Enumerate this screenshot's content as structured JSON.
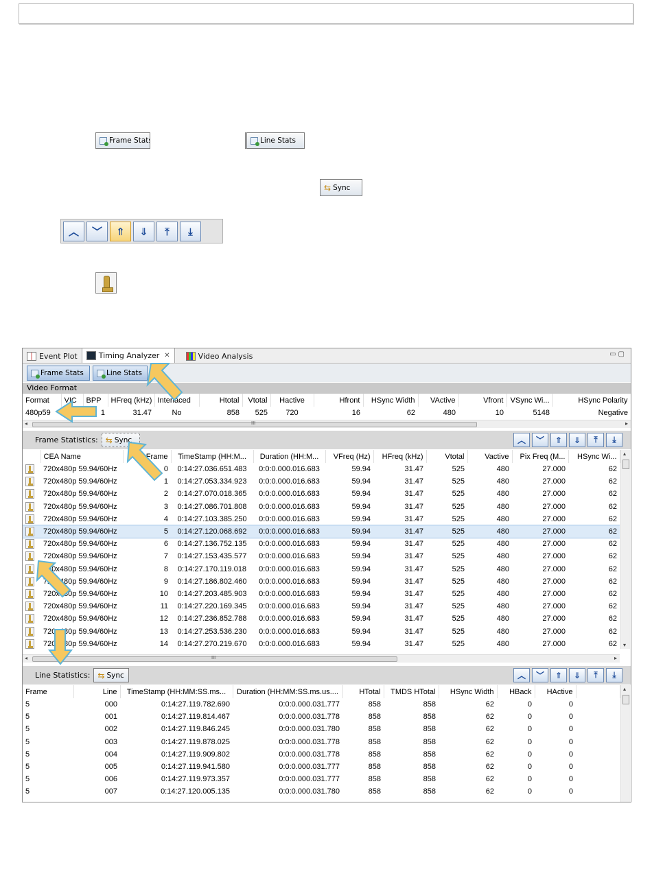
{
  "labels": {
    "frame_stats": "Frame Stats",
    "line_stats": "Line Stats",
    "sync": "Sync"
  },
  "nav_icons": [
    "nav-up-icon",
    "nav-down-icon",
    "nav-page-up-icon",
    "nav-page-down-icon",
    "nav-first-icon",
    "nav-last-icon"
  ],
  "tabs": [
    {
      "label": "Event Plot",
      "icon": "event-plot-icon"
    },
    {
      "label": "Timing Analyzer",
      "icon": "timing-analyzer-icon",
      "active": true
    },
    {
      "label": "Video Analysis",
      "icon": "video-analysis-icon"
    }
  ],
  "video_format": {
    "title": "Video Format",
    "headers": [
      "Format",
      "VIC",
      "BPP",
      "HFreq (kHz)",
      "Interlaced",
      "Htotal",
      "Vtotal",
      "Hactive",
      "Hfront",
      "HSync Width",
      "VActive",
      "Vfront",
      "VSync Wi...",
      "HSync Polarity"
    ],
    "row": [
      "480p59",
      "",
      "1",
      "31.47",
      "No",
      "858",
      "525",
      "720",
      "16",
      "62",
      "480",
      "10",
      "5148",
      "Negative"
    ]
  },
  "frame_statistics": {
    "title": "Frame Statistics:",
    "headers": [
      "",
      "CEA Name",
      "Frame",
      "TimeStamp (HH:M...",
      "Duration (HH:M...",
      "VFreq (Hz)",
      "HFreq (kHz)",
      "Vtotal",
      "Vactive",
      "Pix Freq (M...",
      "HSync Wi..."
    ],
    "selected_index": 5,
    "rows": [
      [
        "720x480p 59.94/60Hz",
        "0",
        "0:14:27.036.651.483",
        "0:0:0.000.016.683",
        "59.94",
        "31.47",
        "525",
        "480",
        "27.000",
        "62"
      ],
      [
        "720x480p 59.94/60Hz",
        "1",
        "0:14:27.053.334.923",
        "0:0:0.000.016.683",
        "59.94",
        "31.47",
        "525",
        "480",
        "27.000",
        "62"
      ],
      [
        "720x480p 59.94/60Hz",
        "2",
        "0:14:27.070.018.365",
        "0:0:0.000.016.683",
        "59.94",
        "31.47",
        "525",
        "480",
        "27.000",
        "62"
      ],
      [
        "720x480p 59.94/60Hz",
        "3",
        "0:14:27.086.701.808",
        "0:0:0.000.016.683",
        "59.94",
        "31.47",
        "525",
        "480",
        "27.000",
        "62"
      ],
      [
        "720x480p 59.94/60Hz",
        "4",
        "0:14:27.103.385.250",
        "0:0:0.000.016.683",
        "59.94",
        "31.47",
        "525",
        "480",
        "27.000",
        "62"
      ],
      [
        "720x480p 59.94/60Hz",
        "5",
        "0:14:27.120.068.692",
        "0:0:0.000.016.683",
        "59.94",
        "31.47",
        "525",
        "480",
        "27.000",
        "62"
      ],
      [
        "720x480p 59.94/60Hz",
        "6",
        "0:14:27.136.752.135",
        "0:0:0.000.016.683",
        "59.94",
        "31.47",
        "525",
        "480",
        "27.000",
        "62"
      ],
      [
        "720x480p 59.94/60Hz",
        "7",
        "0:14:27.153.435.577",
        "0:0:0.000.016.683",
        "59.94",
        "31.47",
        "525",
        "480",
        "27.000",
        "62"
      ],
      [
        "720x480p 59.94/60Hz",
        "8",
        "0:14:27.170.119.018",
        "0:0:0.000.016.683",
        "59.94",
        "31.47",
        "525",
        "480",
        "27.000",
        "62"
      ],
      [
        "720x480p 59.94/60Hz",
        "9",
        "0:14:27.186.802.460",
        "0:0:0.000.016.683",
        "59.94",
        "31.47",
        "525",
        "480",
        "27.000",
        "62"
      ],
      [
        "720x480p 59.94/60Hz",
        "10",
        "0:14:27.203.485.903",
        "0:0:0.000.016.683",
        "59.94",
        "31.47",
        "525",
        "480",
        "27.000",
        "62"
      ],
      [
        "720x480p 59.94/60Hz",
        "11",
        "0:14:27.220.169.345",
        "0:0:0.000.016.683",
        "59.94",
        "31.47",
        "525",
        "480",
        "27.000",
        "62"
      ],
      [
        "720x480p 59.94/60Hz",
        "12",
        "0:14:27.236.852.788",
        "0:0:0.000.016.683",
        "59.94",
        "31.47",
        "525",
        "480",
        "27.000",
        "62"
      ],
      [
        "720x480p 59.94/60Hz",
        "13",
        "0:14:27.253.536.230",
        "0:0:0.000.016.683",
        "59.94",
        "31.47",
        "525",
        "480",
        "27.000",
        "62"
      ],
      [
        "720x480p 59.94/60Hz",
        "14",
        "0:14:27.270.219.670",
        "0:0:0.000.016.683",
        "59.94",
        "31.47",
        "525",
        "480",
        "27.000",
        "62"
      ]
    ]
  },
  "line_statistics": {
    "title": "Line Statistics:",
    "headers": [
      "Frame",
      "Line",
      "TimeStamp (HH:MM:SS.ms...",
      "Duration (HH:MM:SS.ms.us....",
      "HTotal",
      "TMDS HTotal",
      "HSync Width",
      "HBack",
      "HActive"
    ],
    "rows": [
      [
        "5",
        "000",
        "0:14:27.119.782.690",
        "0:0:0.000.031.777",
        "858",
        "858",
        "62",
        "0",
        "0"
      ],
      [
        "5",
        "001",
        "0:14:27.119.814.467",
        "0:0:0.000.031.778",
        "858",
        "858",
        "62",
        "0",
        "0"
      ],
      [
        "5",
        "002",
        "0:14:27.119.846.245",
        "0:0:0.000.031.780",
        "858",
        "858",
        "62",
        "0",
        "0"
      ],
      [
        "5",
        "003",
        "0:14:27.119.878.025",
        "0:0:0.000.031.778",
        "858",
        "858",
        "62",
        "0",
        "0"
      ],
      [
        "5",
        "004",
        "0:14:27.119.909.802",
        "0:0:0.000.031.778",
        "858",
        "858",
        "62",
        "0",
        "0"
      ],
      [
        "5",
        "005",
        "0:14:27.119.941.580",
        "0:0:0.000.031.777",
        "858",
        "858",
        "62",
        "0",
        "0"
      ],
      [
        "5",
        "006",
        "0:14:27.119.973.357",
        "0:0:0.000.031.777",
        "858",
        "858",
        "62",
        "0",
        "0"
      ],
      [
        "5",
        "007",
        "0:14:27.120.005.135",
        "0:0:0.000.031.780",
        "858",
        "858",
        "62",
        "0",
        "0"
      ]
    ]
  },
  "scroll_marker": "III",
  "colors": {
    "callout_fill": "#f6c85f",
    "callout_stroke": "#5fb4d6",
    "selected_row": "#dceaf8"
  }
}
